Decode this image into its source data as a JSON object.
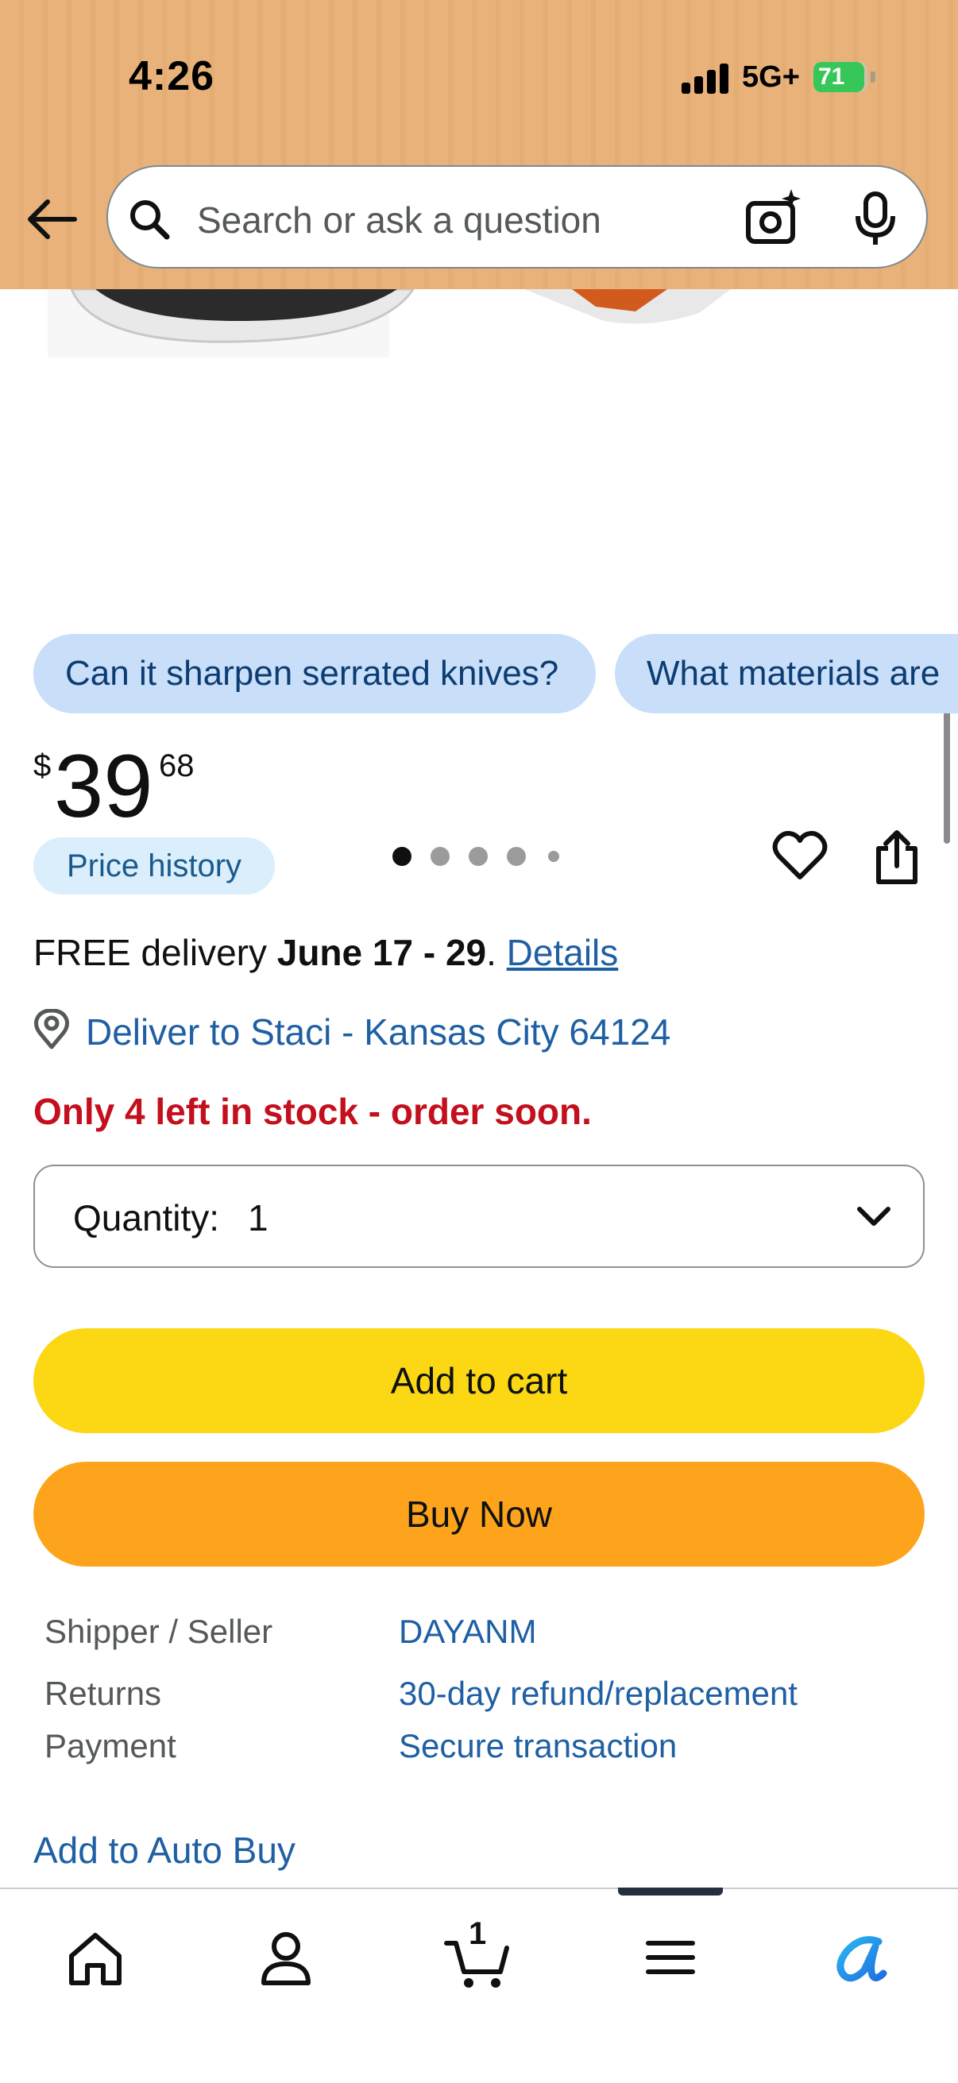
{
  "status_bar": {
    "time": "4:26",
    "network": "5G+",
    "battery": "71"
  },
  "header": {
    "back_icon": "arrow-left-icon",
    "search_placeholder": "Search or ask a question",
    "camera_icon": "camera-sparkle-icon",
    "mic_icon": "microphone-icon"
  },
  "gallery": {
    "image_count": 5,
    "active_index": 0,
    "wishlist_icon": "heart-icon",
    "share_icon": "share-icon"
  },
  "chips": [
    "Can it sharpen serrated knives?",
    "What materials are"
  ],
  "price": {
    "symbol": "$",
    "whole": "39",
    "fraction": "68",
    "history_label": "Price history"
  },
  "delivery": {
    "prefix": "FREE delivery ",
    "dates": "June 17 - 29",
    "separator": ". ",
    "details_link": "Details",
    "location_icon": "location-pin-icon",
    "deliver_to": "Deliver to Staci - Kansas City 64124"
  },
  "stock_message": "Only 4 left in stock - order soon.",
  "quantity": {
    "label": "Quantity:",
    "value": "1"
  },
  "buttons": {
    "add_to_cart": "Add to cart",
    "buy_now": "Buy Now"
  },
  "info_rows": [
    {
      "label": "Shipper / Seller",
      "value": "DAYANM"
    },
    {
      "label": "Returns",
      "value": "30-day refund/replacement"
    },
    {
      "label": "Payment",
      "value": "Secure transaction"
    }
  ],
  "auto_buy": "Add to Auto Buy",
  "bottom_nav": {
    "items": [
      "home-icon",
      "account-icon",
      "cart-icon",
      "menu-icon",
      "rufus-icon"
    ],
    "cart_count": "1"
  },
  "colors": {
    "header_bg": "#e8b27a",
    "link": "#1f5fa3",
    "stock_red": "#c40f1c",
    "add_to_cart": "#fcd713",
    "buy_now": "#fea41c",
    "chip_bg": "#c9def9"
  }
}
